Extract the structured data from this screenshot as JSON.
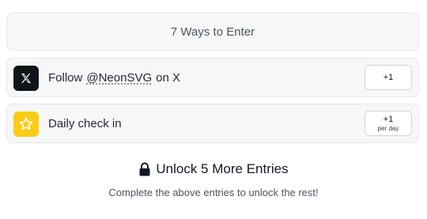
{
  "header": {
    "title": "7 Ways to Enter"
  },
  "entries": [
    {
      "icon": "x-logo-icon",
      "text_before": "Follow",
      "handle": "@NeonSVG",
      "text_after": "on X",
      "points": "+1",
      "points_sub": ""
    },
    {
      "icon": "star-icon",
      "text": "Daily check in",
      "points": "+1",
      "points_sub": "per day"
    }
  ],
  "unlock": {
    "icon": "lock-icon",
    "title": "Unlock 5 More Entries",
    "description": "Complete the above entries to unlock the rest!"
  },
  "colors": {
    "x_bg": "#0f1419",
    "star_bg": "#facc15"
  }
}
